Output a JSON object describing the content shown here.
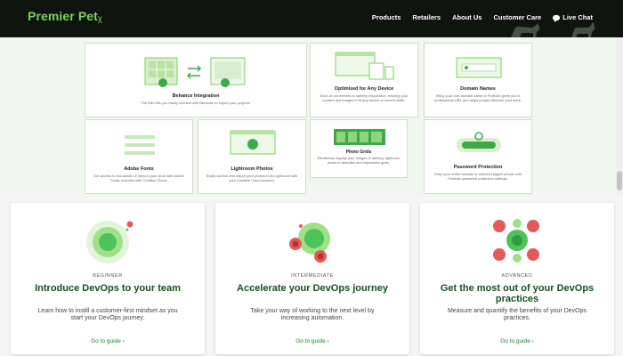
{
  "header": {
    "brand": "Premier Pet",
    "nav": [
      "Products",
      "Retailers",
      "About Us",
      "Customer Care",
      "Live Chat"
    ]
  },
  "features": [
    {
      "title": "Behance Integration",
      "desc": "The folio lets you easily connect with Behance to import your projects.",
      "icon": "behance-grid-icon"
    },
    {
      "title": "Optimized for Any Device",
      "desc": "Each of our themes is natively responsive, resizing your content and images to fit any device or screen width.",
      "icon": "devices-icon"
    },
    {
      "title": "Domain Names",
      "desc": "Bring your own domain name or Portfolio gives you a professional URL and helps people discover your work.",
      "icon": "domain-icon"
    },
    {
      "title": "Adobe Fonts",
      "desc": "Get access to thousands of fonts in your work with Adobe Fonts, included with Creative Cloud.",
      "icon": "fonts-icon"
    },
    {
      "title": "Lightroom Photos",
      "desc": "Easily access and import your photos from Lightroom with your Creative Cloud account.",
      "icon": "lightroom-icon"
    },
    {
      "title": "Photo Grids",
      "desc": "Effortlessly display your images in striking, lightroom photo to beautiful and impressive grids.",
      "icon": "photo-grid-icon"
    },
    {
      "title": "Password Protection",
      "desc": "Keep your entire website or selected pages private with Portfolio password protection settings.",
      "icon": "password-icon"
    }
  ],
  "cards": [
    {
      "level": "BEGINNER",
      "title": "Introduce DevOps to your team",
      "desc": "Learn how to instill a customer-first mindset as you start your DevOps journey.",
      "link": "Go to guide"
    },
    {
      "level": "INTERMEDIATE",
      "title": "Accelerate your DevOps journey",
      "desc": "Take your way of working to the next level by increasing automation.",
      "link": "Go to guide"
    },
    {
      "level": "ADVANCED",
      "title": "Get the most out of your DevOps practices",
      "desc": "Measure and quantify the benefits of your DevOps practices.",
      "link": "Go to guide"
    }
  ],
  "colors": {
    "accent": "#7ed15c",
    "header_bg": "#101310",
    "title_green": "#1a4f1f",
    "link_green": "#1e7f2f",
    "red": "#e35a5a"
  }
}
